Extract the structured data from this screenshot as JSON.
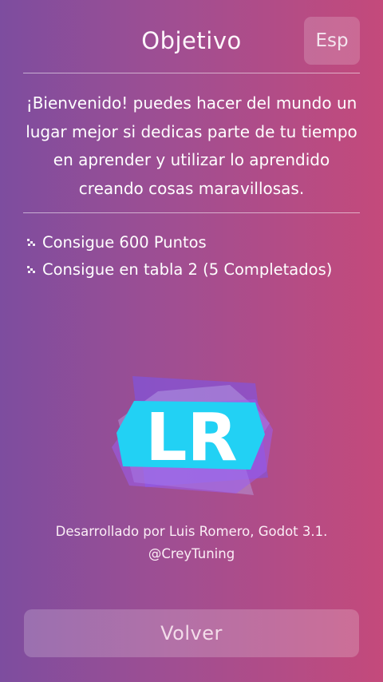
{
  "header": {
    "title": "Objetivo",
    "language_button": "Esp"
  },
  "intro": "¡Bienvenido! puedes hacer del mundo un lugar mejor si dedicas parte de tu tiempo en aprender y utilizar lo aprendido creando cosas maravillosas.",
  "goals": [
    {
      "icon": "dots-bullet-icon",
      "label": "Consigue 600 Puntos"
    },
    {
      "icon": "dots-bullet-icon",
      "label": "Consigue en tabla 2 (5 Completados)"
    }
  ],
  "logo": {
    "text": "LR",
    "accent": "#29d3f5",
    "secondary": "#8b5cf6"
  },
  "credits": {
    "line1": "Desarrollado por Luis Romero, Godot 3.1.",
    "line2": "@CreyTuning"
  },
  "back_button": "Volver"
}
